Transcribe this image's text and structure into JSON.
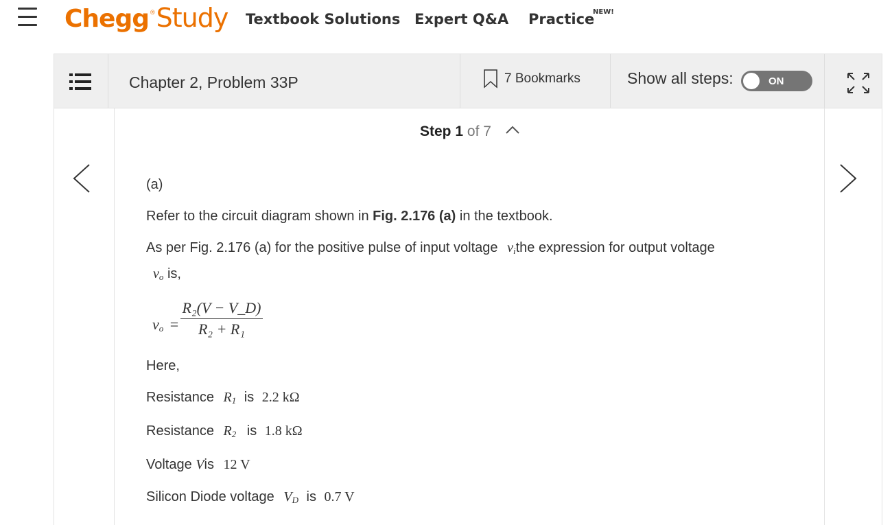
{
  "nav": {
    "logo_chegg": "Chegg",
    "logo_reg": "®",
    "logo_study": "Study",
    "textbook_solutions": "Textbook Solutions",
    "expert_qa": "Expert Q&A",
    "practice": "Practice",
    "new_badge": "NEW!"
  },
  "header": {
    "chapter_title": "Chapter 2, Problem 33P",
    "bookmarks": "7 Bookmarks",
    "show_all_steps": "Show all steps:",
    "toggle_state": "ON"
  },
  "step": {
    "label": "Step",
    "current": "1",
    "of_total": "of 7"
  },
  "content": {
    "part": "(a)",
    "line1_pre": "Refer to the circuit diagram shown in",
    "line1_bold": "Fig. 2.176 (a)",
    "line1_post": "in the textbook.",
    "line2_pre": "As per Fig. 2.176 (a) for the positive pulse of input voltage",
    "vi_var": "v",
    "vi_sub": "i",
    "line2_post": "the expression for output voltage",
    "vo_var": "v",
    "vo_sub": "o",
    "is_comma": "is,",
    "eq_lhs_var": "v",
    "eq_lhs_sub": "o",
    "eq_equals": "=",
    "eq_num": "R₂(V − V_D)",
    "eq_den": "R₂ + R₁",
    "here": "Here,",
    "r1_label": "Resistance",
    "r1_var": "R",
    "r1_sub": "1",
    "r1_is": "is",
    "r1_value": "2.2 kΩ",
    "r2_label": "Resistance",
    "r2_var": "R",
    "r2_sub": "2",
    "r2_is": "is",
    "r2_value": "1.8 kΩ",
    "v_label": "Voltage",
    "v_var": "V",
    "v_is": "is",
    "v_value": "12 V",
    "vd_label": "Silicon Diode voltage",
    "vd_var": "V",
    "vd_sub": "D",
    "vd_is": "is",
    "vd_value": "0.7 V"
  }
}
